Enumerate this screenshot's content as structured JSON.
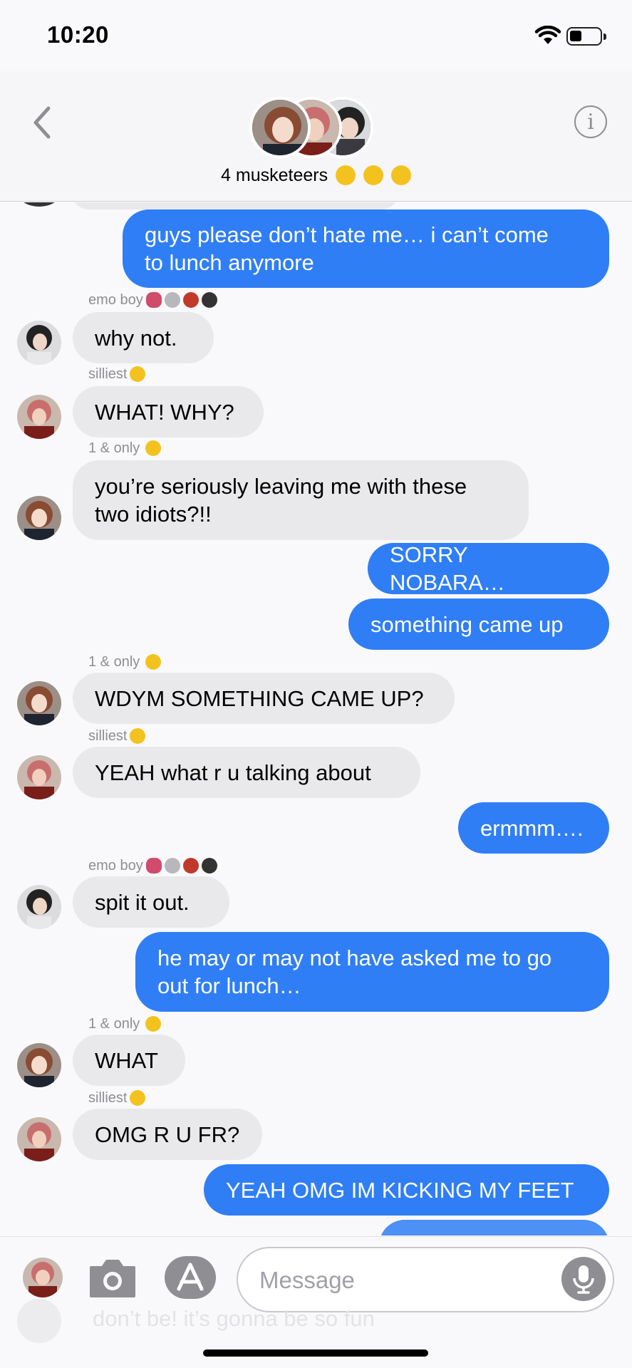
{
  "status_bar": {
    "time": "10:20"
  },
  "header": {
    "group_name": "4 musketeers",
    "back_icon": "chevron-left-icon",
    "info_icon": "info-circle-icon",
    "info_glyph": "i"
  },
  "senders": {
    "emo": "emo boy",
    "silliest": "silliest",
    "one_only": "1 & only"
  },
  "messages": [
    {
      "from": "me",
      "text": "guys please don’t hate me… i can’t come\nto lunch anymore"
    },
    {
      "from": "emo",
      "text": "why not."
    },
    {
      "from": "silliest",
      "text": "WHAT! WHY?"
    },
    {
      "from": "one_only",
      "text": "you’re seriously leaving me with these\ntwo idiots?!!"
    },
    {
      "from": "me",
      "text": "SORRY NOBARA…"
    },
    {
      "from": "me",
      "text": "something came up"
    },
    {
      "from": "one_only",
      "text": "WDYM SOMETHING CAME UP?"
    },
    {
      "from": "silliest",
      "text": "YEAH what r u talking about"
    },
    {
      "from": "me",
      "text": "ermmm…."
    },
    {
      "from": "emo",
      "text": "spit it out."
    },
    {
      "from": "me",
      "text": "he may or may not have asked me to go\nout for lunch…"
    },
    {
      "from": "one_only",
      "text": "WHAT"
    },
    {
      "from": "silliest",
      "text": "OMG R U FR?"
    },
    {
      "from": "me",
      "text": "YEAH OMG IM KICKING MY FEET"
    }
  ],
  "composer": {
    "placeholder": "Message",
    "peek_text": "don’t be! it’s gonna be so fun"
  },
  "colors": {
    "outgoing": "#2f7ef5",
    "incoming": "#e9e9eb",
    "meta": "#8e8e93"
  }
}
